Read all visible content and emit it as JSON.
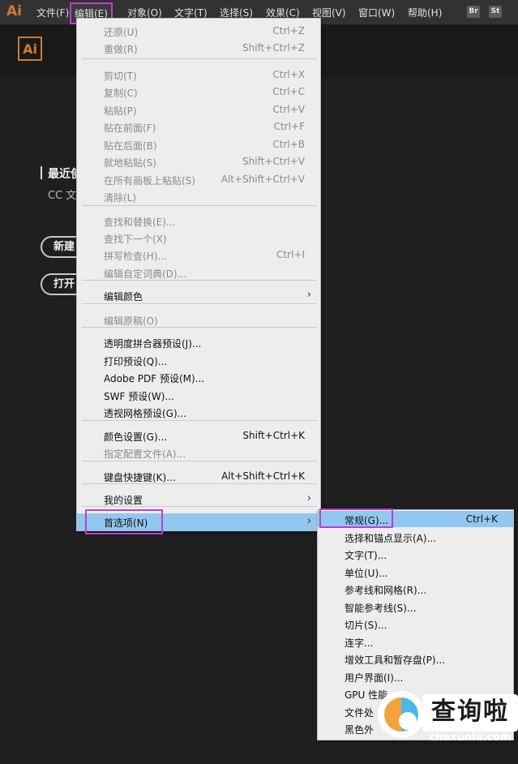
{
  "app": {
    "logo": "Ai",
    "home_logo": "Ai"
  },
  "menubar": {
    "items": [
      "文件(F)",
      "编辑(E)",
      "对象(O)",
      "文字(T)",
      "选择(S)",
      "效果(C)",
      "视图(V)",
      "窗口(W)",
      "帮助(H)"
    ],
    "badges": [
      "Br",
      "St"
    ],
    "active": "编辑(E)"
  },
  "home": {
    "recent_title": "最近使",
    "recent_sub": "CC 文",
    "new_button": "新建",
    "open_button": "打开"
  },
  "edit_menu": [
    {
      "label": "还原(U)",
      "shortcut": "Ctrl+Z",
      "disabled": true
    },
    {
      "label": "重做(R)",
      "shortcut": "Shift+Ctrl+Z",
      "disabled": true
    },
    {
      "label": "剪切(T)",
      "shortcut": "Ctrl+X",
      "disabled": true
    },
    {
      "label": "复制(C)",
      "shortcut": "Ctrl+C",
      "disabled": true
    },
    {
      "label": "粘贴(P)",
      "shortcut": "Ctrl+V",
      "disabled": true
    },
    {
      "label": "贴在前面(F)",
      "shortcut": "Ctrl+F",
      "disabled": true
    },
    {
      "label": "贴在后面(B)",
      "shortcut": "Ctrl+B",
      "disabled": true
    },
    {
      "label": "就地粘贴(S)",
      "shortcut": "Shift+Ctrl+V",
      "disabled": true
    },
    {
      "label": "在所有画板上粘贴(S)",
      "shortcut": "Alt+Shift+Ctrl+V",
      "disabled": true
    },
    {
      "label": "清除(L)",
      "shortcut": "",
      "disabled": true
    },
    {
      "label": "查找和替换(E)...",
      "shortcut": "",
      "disabled": true
    },
    {
      "label": "查找下一个(X)",
      "shortcut": "",
      "disabled": true
    },
    {
      "label": "拼写检查(H)...",
      "shortcut": "Ctrl+I",
      "disabled": true
    },
    {
      "label": "编辑自定词典(D)...",
      "shortcut": "",
      "disabled": true
    },
    {
      "label": "编辑颜色",
      "shortcut": "",
      "disabled": false,
      "submenu": true
    },
    {
      "label": "编辑原稿(O)",
      "shortcut": "",
      "disabled": true
    },
    {
      "label": "透明度拼合器预设(J)...",
      "shortcut": "",
      "disabled": false
    },
    {
      "label": "打印预设(Q)...",
      "shortcut": "",
      "disabled": false
    },
    {
      "label": "Adobe PDF 预设(M)...",
      "shortcut": "",
      "disabled": false
    },
    {
      "label": "SWF 预设(W)...",
      "shortcut": "",
      "disabled": false
    },
    {
      "label": "透视网格预设(G)...",
      "shortcut": "",
      "disabled": false
    },
    {
      "label": "颜色设置(G)...",
      "shortcut": "Shift+Ctrl+K",
      "disabled": false
    },
    {
      "label": "指定配置文件(A)...",
      "shortcut": "",
      "disabled": true
    },
    {
      "label": "键盘快捷键(K)...",
      "shortcut": "Alt+Shift+Ctrl+K",
      "disabled": false
    },
    {
      "label": "我的设置",
      "shortcut": "",
      "disabled": false,
      "submenu": true
    },
    {
      "label": "首选项(N)",
      "shortcut": "",
      "disabled": false,
      "submenu": true,
      "highlighted": true
    }
  ],
  "arrow_glyph": "›",
  "prefs_submenu": [
    {
      "label": "常规(G)...",
      "shortcut": "Ctrl+K",
      "highlighted": true
    },
    {
      "label": "选择和锚点显示(A)..."
    },
    {
      "label": "文字(T)..."
    },
    {
      "label": "单位(U)..."
    },
    {
      "label": "参考线和网格(R)..."
    },
    {
      "label": "智能参考线(S)..."
    },
    {
      "label": "切片(S)..."
    },
    {
      "label": "连字..."
    },
    {
      "label": "增效工具和暂存盘(P)..."
    },
    {
      "label": "用户界面(I)..."
    },
    {
      "label": "GPU 性能"
    },
    {
      "label": "文件处"
    },
    {
      "label": "黑色外"
    }
  ],
  "watermark": {
    "brand": "查询啦",
    "url": "chaxunla.com"
  },
  "colors": {
    "accent_highlight": "#92c7f0",
    "annotation_box": "#c13dd0",
    "logo_orange": "#cc7a36"
  }
}
